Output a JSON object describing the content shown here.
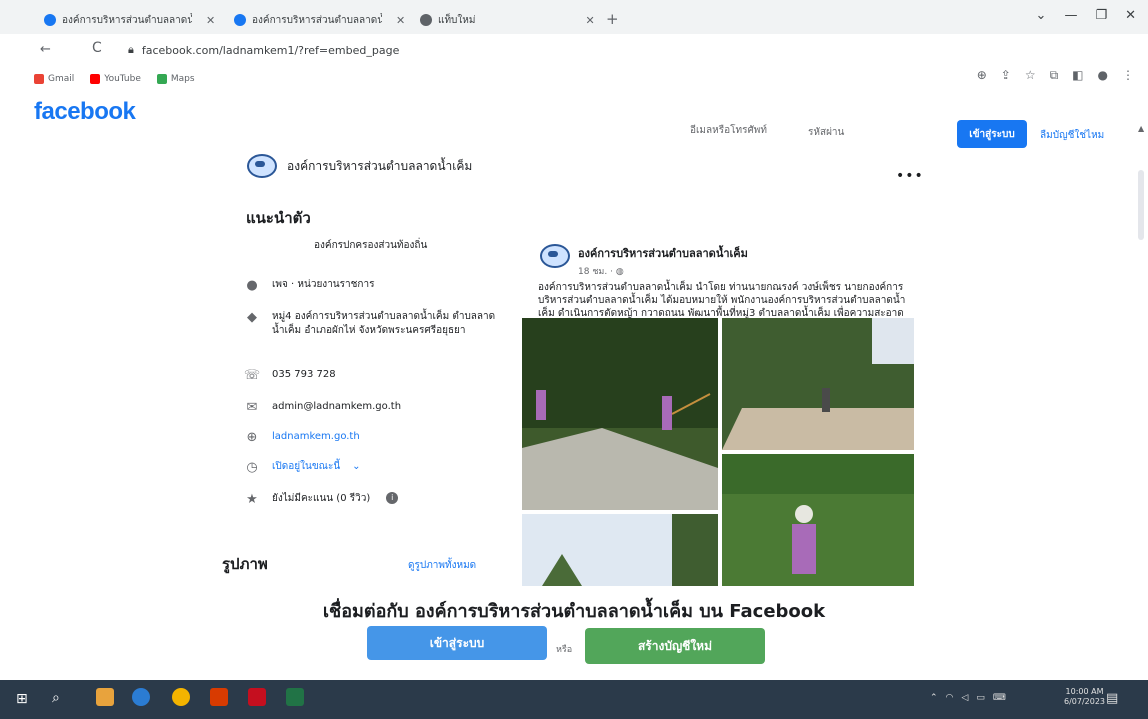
{
  "browser": {
    "tabs": [
      {
        "title": "องค์การบริหารส่วนตำบลลาดน้ำเค็ม",
        "color": "#1877f2"
      },
      {
        "title": "องค์การบริหารส่วนตำบลลาดน้ำเค็ม",
        "color": "#1877f2"
      },
      {
        "title": "แท็บใหม่",
        "color": "#5f6368"
      }
    ],
    "url": "facebook.com/ladnamkem1/?ref=embed_page",
    "bookmarks": [
      {
        "label": "Gmail",
        "color": "#ea4335"
      },
      {
        "label": "YouTube",
        "color": "#ff0000"
      },
      {
        "label": "Maps",
        "color": "#34a853"
      }
    ]
  },
  "header": {
    "logo": "facebook",
    "email_placeholder": "อีเมลหรือโทรศัพท์",
    "password_placeholder": "รหัสผ่าน",
    "login_label": "เข้าสู่ระบบ",
    "forgot_label": "ลืมบัญชีใช่ไหม"
  },
  "page": {
    "name": "องค์การบริหารส่วนตำบลลาดน้ำเค็ม",
    "more": "•••"
  },
  "intro": {
    "title": "แนะนำตัว",
    "subtitle": "องค์กรปกครองส่วนท้องถิ่น",
    "category": "เพจ · หน่วยงานราชการ",
    "address": "หมู่4 องค์การบริหารส่วนตำบลลาดน้ำเค็ม ตำบลลาดน้ำเค็ม อำเภอผักไห่ จังหวัดพระนครศรีอยุธยา",
    "phone": "035 793 728",
    "email": "admin@ladnamkem.go.th",
    "website": "ladnamkem.go.th",
    "hours": "เปิดอยู่ในขณะนี้",
    "rating": "ยังไม่มีคะแนน (0 รีวิว)",
    "info_icon": "i"
  },
  "photos_section": {
    "title": "รูปภาพ",
    "see_all": "ดูรูปภาพทั้งหมด"
  },
  "post": {
    "author": "องค์การบริหารส่วนตำบลลาดน้ำเค็ม",
    "time": "18 ชม. · ",
    "text": "องค์การบริหารส่วนตำบลลาดน้ำเค็ม นำโดย ท่านนายกณรงค์ วงษ์เพ็ชร นายกองค์การบริหารส่วนตำบลลาดน้ำเค็ม ได้มอบหมายให้ พนักงานองค์การบริหารส่วนตำบลลาดน้ำเค็ม ดำเนินการตัดหญ้า กวาดถนน พัฒนาพื้นที่หมู่3 ตำบลลาดน้ำเค็ม เพื่อความสะอาด เป็นระเบียบเรียบร้อย"
  },
  "footer": {
    "connect_text": "เชื่อมต่อกับ องค์การบริหารส่วนตำบลลาดน้ำเค็ม บน Facebook",
    "login_label": "เข้าสู่ระบบ",
    "or_label": "หรือ",
    "create_label": "สร้างบัญชีใหม่"
  },
  "taskbar": {
    "clock_time": "10:00 AM",
    "clock_date": "6/07/2023",
    "app_colors": [
      "#e8a33d",
      "#2b7cd3",
      "#f4b400",
      "#d83b01",
      "#c50f1f",
      "#217346"
    ]
  }
}
